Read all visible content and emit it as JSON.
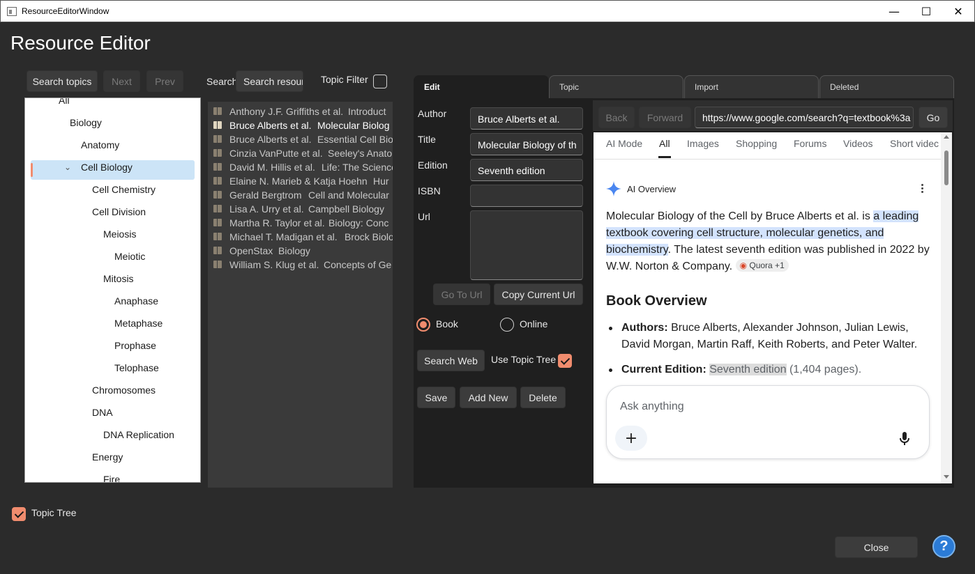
{
  "window": {
    "title": "ResourceEditorWindow",
    "minimize": "—",
    "maximize": "☐",
    "close": "✕"
  },
  "page_title": "Resource Editor",
  "topics": {
    "search_label": "Search topics",
    "next_label": "Next",
    "prev_label": "Prev",
    "tree": [
      {
        "label": "All",
        "level": 0
      },
      {
        "label": "Biology",
        "level": 1
      },
      {
        "label": "Anatomy",
        "level": 2
      },
      {
        "label": "Cell Biology",
        "level": 2,
        "expanded": true,
        "selected": true
      },
      {
        "label": "Cell Chemistry",
        "level": 3
      },
      {
        "label": "Cell Division",
        "level": 3
      },
      {
        "label": "Meiosis",
        "level": 4
      },
      {
        "label": "Meiotic",
        "level": 5
      },
      {
        "label": "Mitosis",
        "level": 4
      },
      {
        "label": "Anaphase",
        "level": 5
      },
      {
        "label": "Metaphase",
        "level": 5
      },
      {
        "label": "Prophase",
        "level": 5
      },
      {
        "label": "Telophase",
        "level": 5
      },
      {
        "label": "Chromosomes",
        "level": 3
      },
      {
        "label": "DNA",
        "level": 3
      },
      {
        "label": "DNA Replication",
        "level": 4
      },
      {
        "label": "Energy",
        "level": 3
      },
      {
        "label": "Fire",
        "level": 4
      }
    ],
    "expander": "⌄"
  },
  "resources": {
    "search_label": "Search",
    "search_placeholder": "Search resour",
    "topic_filter_label": "Topic Filter",
    "items": [
      {
        "author": "Anthony J.F. Griffiths et al.",
        "title": "Introduct"
      },
      {
        "author": "Bruce Alberts et al.",
        "title": "Molecular Biolog",
        "selected": true
      },
      {
        "author": "Bruce Alberts et al.",
        "title": "Essential Cell Bio"
      },
      {
        "author": "Cinzia VanPutte et al.",
        "title": "Seeley's Anato"
      },
      {
        "author": "David M. Hillis et al.",
        "title": "Life: The Science"
      },
      {
        "author": "Elaine N. Marieb & Katja Hoehn",
        "title": "Hur"
      },
      {
        "author": "Gerald Bergtrom",
        "title": "Cell and Molecular"
      },
      {
        "author": "Lisa A. Urry et al.",
        "title": "Campbell Biology"
      },
      {
        "author": "Martha R. Taylor et al.",
        "title": "Biology: Conc"
      },
      {
        "author": "Michael T. Madigan et al.",
        "title": "Brock Biolo"
      },
      {
        "author": "OpenStax",
        "title": "Biology"
      },
      {
        "author": "William S. Klug et al.",
        "title": "Concepts of Ge"
      }
    ]
  },
  "tabs": [
    "Edit",
    "Topic",
    "Import",
    "Deleted"
  ],
  "edit": {
    "author_label": "Author",
    "author_value": "Bruce Alberts et al.",
    "title_label": "Title",
    "title_value": "Molecular Biology of th",
    "edition_label": "Edition",
    "edition_value": "Seventh edition",
    "isbn_label": "ISBN",
    "isbn_value": "",
    "url_label": "Url",
    "url_value": "",
    "goto_url": "Go To Url",
    "copy_url": "Copy Current Url",
    "type_book": "Book",
    "type_online": "Online",
    "search_web": "Search Web",
    "use_topic_tree": "Use Topic Tree",
    "save": "Save",
    "add_new": "Add New",
    "delete": "Delete"
  },
  "browser": {
    "back": "Back",
    "forward": "Forward",
    "url": "https://www.google.com/search?q=textbook%3a",
    "go": "Go",
    "google_tabs": [
      "AI Mode",
      "All",
      "Images",
      "Shopping",
      "Forums",
      "Videos",
      "Short videc"
    ],
    "ai_overview_label": "AI Overview",
    "para_start": "Molecular Biology of the Cell by Bruce Alberts et al. is ",
    "para_highlight": "a leading textbook covering cell structure, molecular genetics, and biochemistry",
    "para_end": ". The latest seventh edition was published in 2022 by W.W. Norton & Company.",
    "source_chip": "Quora +1",
    "section_heading": "Book Overview",
    "authors_label": "Authors:",
    "authors_value": " Bruce Alberts, Alexander Johnson, Julian Lewis, David Morgan, Martin Raff, Keith Roberts, and Peter Walter.",
    "edition_label": "Current Edition:",
    "edition_value": "Seventh edition",
    "edition_pages": " (1,404 pages).",
    "ask_placeholder": "Ask anything"
  },
  "footer": {
    "topic_tree_label": "Topic Tree",
    "close": "Close",
    "help": "?"
  },
  "colors": {
    "accent": "#f08c6e",
    "background": "#2b2b2b",
    "selection": "#cce4f7",
    "help": "#2b7bd6"
  }
}
